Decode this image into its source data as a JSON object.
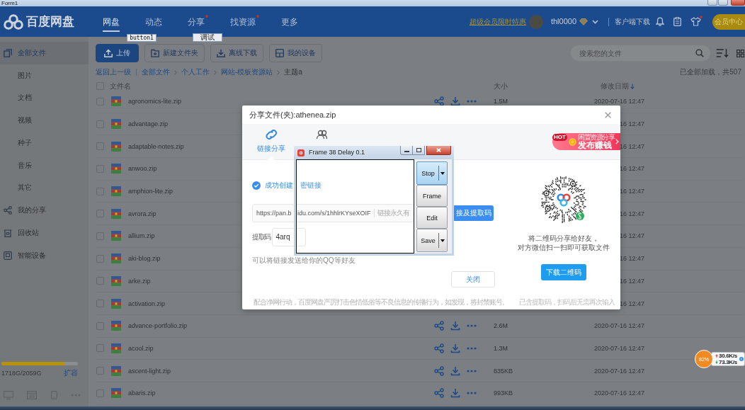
{
  "form_window": {
    "title": "Form1"
  },
  "header": {
    "logo": "百度网盘",
    "nav": [
      {
        "label": "网盘",
        "selected": true,
        "dot": false
      },
      {
        "label": "动态",
        "selected": false,
        "dot": false
      },
      {
        "label": "分享",
        "selected": false,
        "dot": true
      },
      {
        "label": "找资源",
        "selected": false,
        "dot": true
      },
      {
        "label": "更多",
        "selected": false,
        "dot": false
      }
    ],
    "promo_link": "超级会员限时特惠",
    "username": "thl0000",
    "client_download": "客户端下载",
    "skin_dot": true,
    "vip_button": "会员中心"
  },
  "debug_buttons": [
    "button1",
    "调试"
  ],
  "sidebar": {
    "items": [
      {
        "label": "全部文件",
        "kind": "files",
        "selected": true
      },
      {
        "label": "图片",
        "kind": "category",
        "selected": false
      },
      {
        "label": "文档",
        "kind": "category",
        "selected": false
      },
      {
        "label": "视频",
        "kind": "category",
        "selected": false
      },
      {
        "label": "种子",
        "kind": "category",
        "selected": false
      },
      {
        "label": "音乐",
        "kind": "category",
        "selected": false
      },
      {
        "label": "其它",
        "kind": "category",
        "selected": false
      },
      {
        "label": "我的分享",
        "kind": "share",
        "selected": false
      },
      {
        "label": "回收站",
        "kind": "trash",
        "selected": false
      },
      {
        "label": "智能设备",
        "kind": "device",
        "selected": false
      }
    ],
    "storage": {
      "level": 0.83,
      "usage": "1718G/2059G",
      "expand": "扩容"
    }
  },
  "toolbar": {
    "buttons": [
      {
        "label": "上传",
        "kind": "upload"
      },
      {
        "label": "新建文件夹",
        "kind": "new-folder"
      },
      {
        "label": "离线下载",
        "kind": "offline-download"
      },
      {
        "label": "我的设备",
        "kind": "devices"
      }
    ],
    "search": {
      "placeholder": "搜索您的文件"
    }
  },
  "breadcrumb": {
    "back": "返回上一级",
    "path": [
      "全部文件",
      "个人工作",
      "网站-模板资源站",
      "主题a"
    ],
    "status": "已全部加载，共507"
  },
  "table": {
    "select_all": false,
    "columns": [
      "文件名",
      "大小",
      "修改日期"
    ],
    "rows": [
      {
        "name": "agronomics-lite.zip",
        "size": "1.5M",
        "date": "2020-07-16 12:47",
        "actions": true,
        "checked": false
      },
      {
        "name": "advantage.zip",
        "date": "16 12:47",
        "actions": false,
        "checked": false
      },
      {
        "name": "adaptable-notes.zip",
        "date": "16 12:47",
        "actions": false,
        "checked": false
      },
      {
        "name": "anwoo.zip",
        "date": "16 12:47",
        "actions": false,
        "checked": false
      },
      {
        "name": "amphion-lite.zip",
        "date": "16 12:47",
        "actions": false,
        "checked": false
      },
      {
        "name": "avrora.zip",
        "date": "16 12:47",
        "actions": false,
        "checked": false
      },
      {
        "name": "allium.zip",
        "date": "16 12:47",
        "actions": false,
        "checked": false
      },
      {
        "name": "aki-blog.zip",
        "date": "16 12:47",
        "actions": false,
        "checked": false
      },
      {
        "name": "arke.zip",
        "date": "16 12:47",
        "actions": false,
        "checked": false
      },
      {
        "name": "activation.zip",
        "date": "16 12:47",
        "actions": false,
        "checked": false
      },
      {
        "name": "advance-portfolio.zip",
        "size": "2.6M",
        "date": "2020-07-16 12:47",
        "actions": true,
        "checked": false
      },
      {
        "name": "acool.zip",
        "size": "1.3M",
        "date": "2020-07-16 12:47",
        "actions": true,
        "checked": false
      },
      {
        "name": "ascent-light.zip",
        "size": "835KB",
        "date": "2020-07-16 12:47",
        "actions": true,
        "checked": false
      },
      {
        "name": "abaris.zip",
        "size": "993KB",
        "date": "2020-07-16 12:47",
        "actions": true,
        "checked": false
      }
    ]
  },
  "share_dialog": {
    "title": "分享文件(夹):athenea.zip",
    "tabs": [
      {
        "label": "链接分享",
        "kind": "link",
        "selected": true
      },
      {
        "kind": "friends",
        "selected": false
      }
    ],
    "promo": {
      "badge": "HOT",
      "subtitle": "闲置资源分享",
      "title": "发布赚钱"
    },
    "success": [
      "成功创建",
      "密链接"
    ],
    "link": {
      "value": [
        "https://pan.b",
        "idu.com/s/1hhlrKYseXOIF"
      ],
      "validity": "链接永久有"
    },
    "copy_button": "接及提取码",
    "code": {
      "label": "提取码",
      "value": "4arq"
    },
    "hint": "可以将链接发送给你的QQ等好友",
    "close_button": "关闭",
    "qr_caption": [
      "将二维码分享给好友，",
      "对方微信扫一扫即可获取文件"
    ],
    "qr_button": "下载二维码",
    "notice": "配合净网行动，百度网盘严厉打击色情低俗等不良信息的传播行为，如发现，将封禁账号。",
    "qr_note": "已含提取码，扫码后无需再次输入"
  },
  "recorder": {
    "title": "Frame 38 Delay 0.1",
    "buttons": [
      {
        "label": "Stop",
        "selected": true,
        "dropdown": true
      },
      {
        "label": "Frame",
        "selected": false,
        "dropdown": false
      },
      {
        "label": "Edit",
        "selected": false,
        "dropdown": false
      },
      {
        "label": "Save",
        "selected": false,
        "dropdown": true
      }
    ]
  },
  "speed_widget": {
    "cpu": "82%",
    "upload": "30.6K/s",
    "download": "73.3K/s"
  }
}
